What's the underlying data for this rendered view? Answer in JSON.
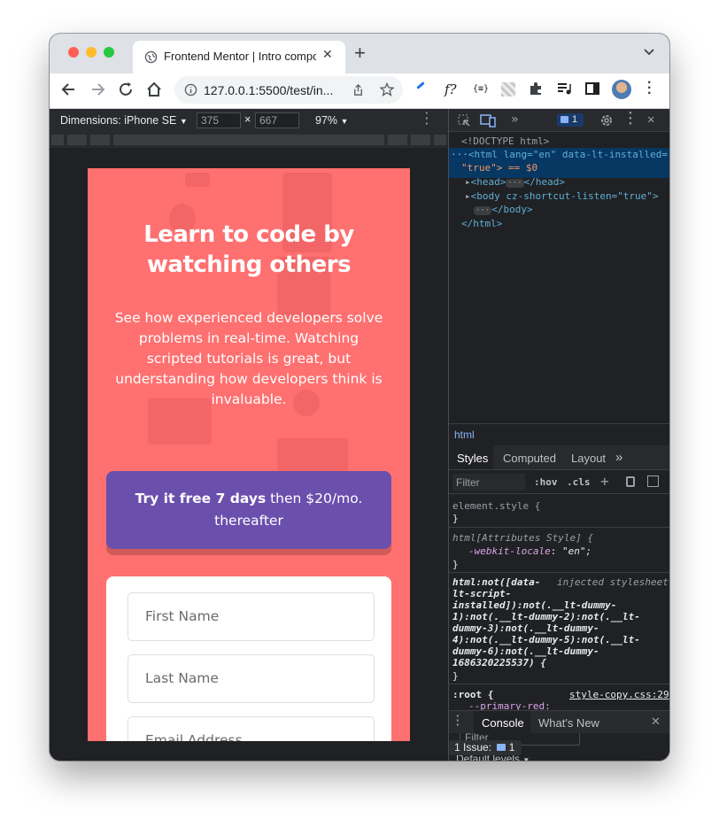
{
  "browser": {
    "tab_title": "Frontend Mentor | Intro compo",
    "new_tab": "+",
    "url": "127.0.0.1:5500/test/in...",
    "extension_label": "f?"
  },
  "device_toolbar": {
    "dimensions_label": "Dimensions: iPhone SE",
    "width": "375",
    "times": "×",
    "height": "667",
    "zoom": "97%"
  },
  "page": {
    "title": "Learn to code by watching others",
    "body": "See how experienced developers solve problems in real-time. Watching scripted tutorials is great, but understanding how developers think is invaluable.",
    "trial_bold": "Try it free 7 days",
    "trial_rest": " then $20/mo. thereafter",
    "fields": [
      "First Name",
      "Last Name",
      "Email Address"
    ],
    "colors": {
      "background": "#ff7070",
      "trial": "#6a4fad"
    }
  },
  "devtools": {
    "issues_badge": "1",
    "dom": {
      "doctype": "<!DOCTYPE html>",
      "html_open_1": "<html lang=\"en\" data-lt-installed=",
      "html_open_2": "\"true\"> == $0",
      "head": "<head>",
      "head_close": "</head>",
      "body": "<body cz-shortcut-listen=\"true\">",
      "body_close": "</body>",
      "html_close": "</html>"
    },
    "breadcrumb": "html",
    "style_tabs": [
      "Styles",
      "Computed",
      "Layout"
    ],
    "filter_placeholder": "Filter",
    "hov": ":hov",
    "cls": ".cls",
    "rules": {
      "element_style": "element.style {",
      "close": "}",
      "attr_selector": "html[Attributes Style] {",
      "locale_prop": "-webkit-locale",
      "locale_val": "\"en\";",
      "injected_sel_1": "html:not([data-",
      "injected_label": "injected stylesheet",
      "injected_sel_2": "lt-script-",
      "injected_sel_3": "installed]):not(.__lt-dummy-",
      "injected_sel_4": "1):not(.__lt-dummy-2):not(.__lt-",
      "injected_sel_5": "dummy-3):not(.__lt-dummy-",
      "injected_sel_6": "4):not(.__lt-dummy-5):not(.__lt-",
      "injected_sel_7": "dummy-6):not(.__lt-dummy-",
      "injected_sel_8": "1686320225537) {",
      "root_sel": ":root {",
      "root_source": "style-copy.css:29",
      "root_prop": "--primary-red:"
    },
    "console_tabs": [
      "Console",
      "What's New"
    ],
    "console_filter": "Filter",
    "default_levels": "Default levels",
    "issues_text": "1 Issue:",
    "issues_count": "1"
  }
}
